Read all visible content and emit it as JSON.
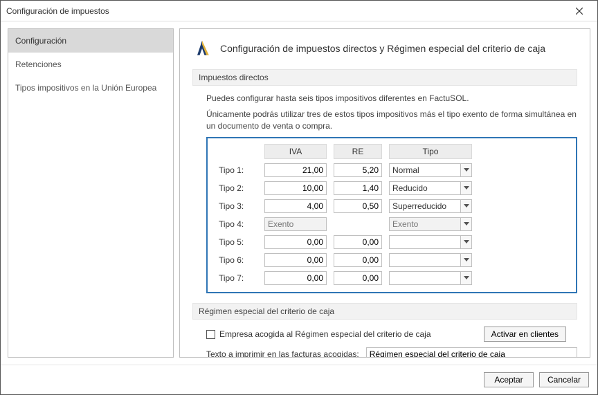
{
  "window": {
    "title": "Configuración de impuestos"
  },
  "sidebar": {
    "items": [
      {
        "label": "Configuración",
        "active": true
      },
      {
        "label": "Retenciones",
        "active": false
      },
      {
        "label": "Tipos impositivos en la Unión Europea",
        "active": false
      }
    ]
  },
  "heading": "Configuración de impuestos directos y Régimen especial del criterio de caja",
  "sections": {
    "direct": {
      "title": "Impuestos directos",
      "desc1": "Puedes configurar hasta seis tipos impositivos diferentes en FactuSOL.",
      "desc2": "Únicamente podrás utilizar tres de estos tipos impositivos más el tipo exento de forma simultánea en un documento de venta o compra.",
      "columns": {
        "iva": "IVA",
        "re": "RE",
        "tipo": "Tipo"
      },
      "rows": [
        {
          "label": "Tipo 1:",
          "iva": "21,00",
          "re": "5,20",
          "tipo": "Normal",
          "disabled": false
        },
        {
          "label": "Tipo 2:",
          "iva": "10,00",
          "re": "1,40",
          "tipo": "Reducido",
          "disabled": false
        },
        {
          "label": "Tipo 3:",
          "iva": "4,00",
          "re": "0,50",
          "tipo": "Superreducido",
          "disabled": false
        },
        {
          "label": "Tipo 4:",
          "iva": "Exento",
          "re": "",
          "tipo": "Exento",
          "disabled": true
        },
        {
          "label": "Tipo 5:",
          "iva": "0,00",
          "re": "0,00",
          "tipo": "",
          "disabled": false
        },
        {
          "label": "Tipo 6:",
          "iva": "0,00",
          "re": "0,00",
          "tipo": "",
          "disabled": false
        },
        {
          "label": "Tipo 7:",
          "iva": "0,00",
          "re": "0,00",
          "tipo": "",
          "disabled": false
        }
      ]
    },
    "regimen": {
      "title": "Régimen especial del criterio de caja",
      "checkbox_label": "Empresa acogida al Régimen especial del criterio de caja",
      "activate_button": "Activar en clientes",
      "print_label": "Texto a imprimir en las facturas acogidas:",
      "print_value": "Régimen especial del criterio de caja"
    }
  },
  "buttons": {
    "accept": "Aceptar",
    "cancel": "Cancelar"
  }
}
